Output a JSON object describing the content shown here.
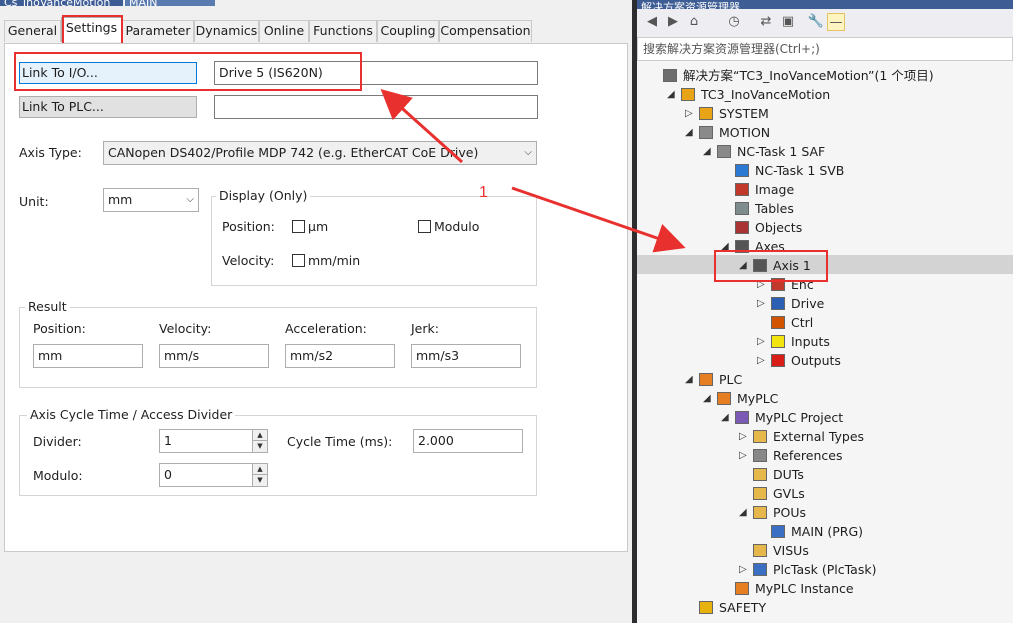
{
  "doc_tabs": [
    "Cs_InoVanceMotion",
    "MAIN"
  ],
  "tabs": [
    {
      "label": "General",
      "active": false
    },
    {
      "label": "Settings",
      "active": true
    },
    {
      "label": "Parameter",
      "active": false
    },
    {
      "label": "Dynamics",
      "active": false
    },
    {
      "label": "Online",
      "active": false
    },
    {
      "label": "Functions",
      "active": false
    },
    {
      "label": "Coupling",
      "active": false
    },
    {
      "label": "Compensation",
      "active": false
    }
  ],
  "settings": {
    "link_io_label": "Link To I/O...",
    "link_io_value": "Drive 5 (IS620N)",
    "link_plc_label": "Link To PLC...",
    "link_plc_value": "",
    "axis_type_label": "Axis Type:",
    "axis_type_value": "CANopen DS402/Profile MDP 742 (e.g. EtherCAT CoE Drive)",
    "unit_label": "Unit:",
    "unit_value": "mm",
    "display_title": "Display (Only)",
    "display_position_label": "Position:",
    "display_velocity_label": "Velocity:",
    "display_um": "µm",
    "display_mm_min": "mm/min",
    "display_modulo": "Modulo",
    "result_title": "Result",
    "result_labels": [
      "Position:",
      "Velocity:",
      "Acceleration:",
      "Jerk:"
    ],
    "result_values": [
      "mm",
      "mm/s",
      "mm/s2",
      "mm/s3"
    ],
    "cycle_title": "Axis Cycle Time / Access Divider",
    "divider_label": "Divider:",
    "divider_value": "1",
    "modulo_label": "Modulo:",
    "modulo_value": "0",
    "cycle_time_label": "Cycle Time (ms):",
    "cycle_time_value": "2.000"
  },
  "annotation": {
    "number": "1",
    "color": "#e8302f"
  },
  "explorer": {
    "title": "解决方案资源管理器",
    "search_placeholder": "搜索解决方案资源管理器(Ctrl+;)",
    "nodes": [
      {
        "label": "解决方案“TC3_InoVanceMotion”(1 个项目)",
        "icon": "solution-icon"
      },
      {
        "label": "TC3_InoVanceMotion",
        "icon": "project-icon"
      },
      {
        "label": "SYSTEM",
        "icon": "system-icon"
      },
      {
        "label": "MOTION",
        "icon": "motion-icon"
      },
      {
        "label": "NC-Task 1 SAF",
        "icon": "task-icon"
      },
      {
        "label": "NC-Task 1 SVB",
        "icon": "svb-icon"
      },
      {
        "label": "Image",
        "icon": "image-icon"
      },
      {
        "label": "Tables",
        "icon": "tables-icon"
      },
      {
        "label": "Objects",
        "icon": "objects-icon"
      },
      {
        "label": "Axes",
        "icon": "axes-icon"
      },
      {
        "label": "Axis 1",
        "icon": "axis-icon"
      },
      {
        "label": "Enc",
        "icon": "encoder-icon"
      },
      {
        "label": "Drive",
        "icon": "drive-icon"
      },
      {
        "label": "Ctrl",
        "icon": "ctrl-icon"
      },
      {
        "label": "Inputs",
        "icon": "inputs-icon"
      },
      {
        "label": "Outputs",
        "icon": "outputs-icon"
      },
      {
        "label": "PLC",
        "icon": "plc-icon"
      },
      {
        "label": "MyPLC",
        "icon": "myplc-icon"
      },
      {
        "label": "MyPLC Project",
        "icon": "plc-project-icon"
      },
      {
        "label": "External Types",
        "icon": "folder-icon"
      },
      {
        "label": "References",
        "icon": "references-icon"
      },
      {
        "label": "DUTs",
        "icon": "folder-icon"
      },
      {
        "label": "GVLs",
        "icon": "folder-icon"
      },
      {
        "label": "POUs",
        "icon": "folder-open-icon"
      },
      {
        "label": "MAIN (PRG)",
        "icon": "program-icon"
      },
      {
        "label": "VISUs",
        "icon": "folder-icon"
      },
      {
        "label": "PlcTask (PlcTask)",
        "icon": "plctask-icon"
      },
      {
        "label": "MyPLC Instance",
        "icon": "instance-icon"
      },
      {
        "label": "SAFETY",
        "icon": "safety-icon"
      }
    ]
  }
}
